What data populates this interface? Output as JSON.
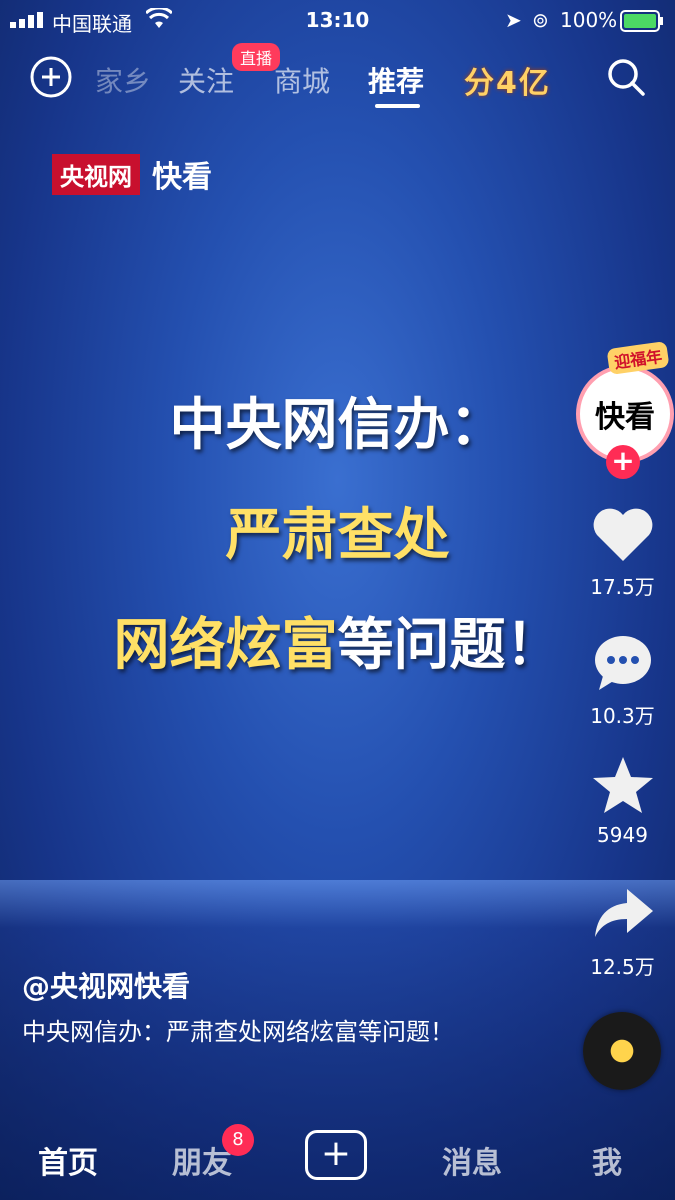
{
  "status_bar": {
    "carrier": "中国联通",
    "time": "13:10",
    "battery": "100%"
  },
  "top_nav": {
    "items": [
      "家乡",
      "关注",
      "商城",
      "推荐"
    ],
    "live_badge": "直播",
    "promo": "分4亿",
    "active": "推荐"
  },
  "video": {
    "logo_red": "央视网",
    "logo_white": "快看",
    "headline_line1": "中央网信办：",
    "headline_line2": "严肃查处",
    "headline_line3_yellow": "网络炫富",
    "headline_line3_white": "等问题！"
  },
  "side": {
    "avatar_label": "快看",
    "avatar_tag": "迎福年",
    "likes": "17.5万",
    "comments": "10.3万",
    "favorites": "5949",
    "shares": "12.5万"
  },
  "caption": {
    "author": "@央视网快看",
    "description": "中央网信办：严肃查处网络炫富等问题！"
  },
  "bottom_nav": {
    "home": "首页",
    "friends": "朋友",
    "friends_badge": "8",
    "messages": "消息",
    "me": "我"
  }
}
